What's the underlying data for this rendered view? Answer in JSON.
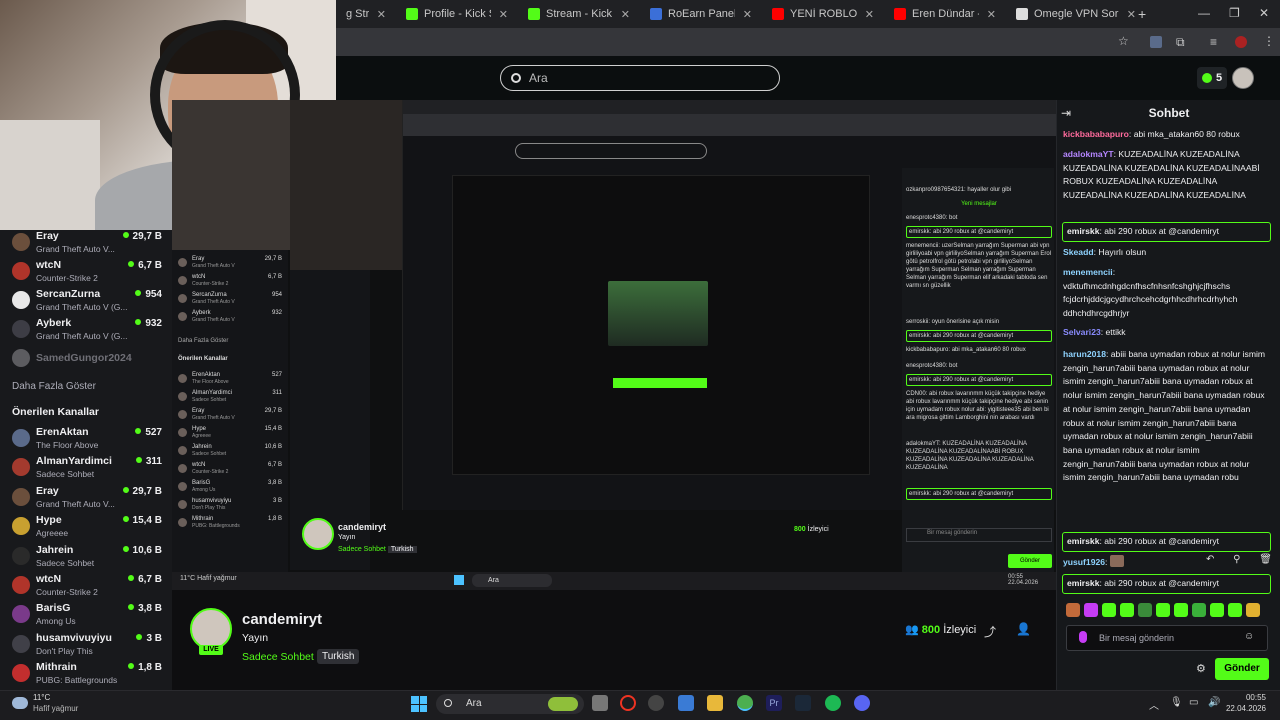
{
  "browser": {
    "tabs": [
      {
        "label": "g Stream",
        "color": "#53fc18"
      },
      {
        "label": "Profile - Kick Streami",
        "color": "#53fc18"
      },
      {
        "label": "Stream - Kick Dashbo",
        "color": "#53fc18"
      },
      {
        "label": "RoEarn Paneli",
        "color": "#3b6fd8"
      },
      {
        "label": "YENİ ROBLOX ÇIKTI",
        "color": "#ff0000"
      },
      {
        "label": "Eren Dündar - YouTu",
        "color": "#ff0000"
      },
      {
        "label": "Omegle VPN Sorunu",
        "color": "#dddddd"
      }
    ],
    "new_tab": "+"
  },
  "header": {
    "search_placeholder": "Ara",
    "points": "5"
  },
  "sidebar": {
    "channels_top": [
      {
        "name": "Eray",
        "game": "Grand Theft Auto V...",
        "viewers": "29,7 B",
        "avatar": "#6b4f3c"
      },
      {
        "name": "wtcN",
        "game": "Counter-Strike 2",
        "viewers": "6,7 B",
        "avatar": "#b0342a"
      },
      {
        "name": "SercanZurna",
        "game": "Grand Theft Auto V (G...",
        "viewers": "954",
        "avatar": "#e8e8e8"
      },
      {
        "name": "Ayberk",
        "game": "Grand Theft Auto V (G...",
        "viewers": "932",
        "avatar": "#3d3d45"
      },
      {
        "name": "SamedGungor2024",
        "game": "",
        "viewers": "",
        "avatar": "#5c5c60"
      }
    ],
    "show_more": "Daha Fazla Göster",
    "recommended_title": "Önerilen Kanallar",
    "recommended": [
      {
        "name": "ErenAktan",
        "game": "The Floor Above",
        "viewers": "527",
        "avatar": "#5a6a8a"
      },
      {
        "name": "AlmanYardimci",
        "game": "Sadece Sohbet",
        "viewers": "311",
        "avatar": "#a33a2e"
      },
      {
        "name": "Eray",
        "game": "Grand Theft Auto V...",
        "viewers": "29,7 B",
        "avatar": "#6b4f3c"
      },
      {
        "name": "Hype",
        "game": "Agreeee",
        "viewers": "15,4 B",
        "avatar": "#c8a030"
      },
      {
        "name": "Jahrein",
        "game": "Sadece Sohbet",
        "viewers": "10,6 B",
        "avatar": "#2a2a2a"
      },
      {
        "name": "wtcN",
        "game": "Counter-Strike 2",
        "viewers": "6,7 B",
        "avatar": "#b0342a"
      },
      {
        "name": "BarisG",
        "game": "Among Us",
        "viewers": "3,8 B",
        "avatar": "#7a3a8a"
      },
      {
        "name": "husamvivuyiyu",
        "game": "Don't Play This",
        "viewers": "3 B",
        "avatar": "#404048"
      },
      {
        "name": "Mithrain",
        "game": "PUBG: Battlegrounds",
        "viewers": "1,8 B",
        "avatar": "#c22e2e"
      }
    ]
  },
  "stream": {
    "streamer": "candemiryt",
    "live": "LIVE",
    "title": "Yayın",
    "category": "Sadece Sohbet",
    "language": "Turkish",
    "viewers": "800",
    "viewers_label": "İzleyici"
  },
  "chat": {
    "title": "Sohbet",
    "messages": [
      {
        "user": "kickbababapuro",
        "color": "#ff6b9d",
        "text": "abi mka_atakan60 80 robux",
        "highlight": false
      },
      {
        "user": "adalokmaYT",
        "color": "#b586ff",
        "text": "KUZEADALİNA KUZEADALİNA KUZEADALİNA KUZEADALİNA KUZEADALİNAABİ ROBUX KUZEADALİNA KUZEADALİNA KUZEADALİNA KUZEADALİNA KUZEADALİNA",
        "highlight": false
      },
      {
        "user": "emirskk",
        "color": "#efeff1",
        "text": "abi 290 robux at @candemiryt",
        "highlight": true
      },
      {
        "user": "Skeadd",
        "color": "#8fd3ff",
        "text": "Hayırlı olsun",
        "highlight": false
      },
      {
        "user": "menemencii",
        "color": "#8fd3ff",
        "text": "vdktufhmcdnhgdcnfhscfnhsnfcshghjcjfhschs fcjdcrhjddcjgcydhrchcehcdgrhhcdhrhcdrhyhch ddhchdhrcgdhrjyr",
        "highlight": false
      },
      {
        "user": "Selvari23",
        "color": "#8a8cff",
        "text": "ettikk",
        "highlight": false
      },
      {
        "user": "harun2018",
        "color": "#8fd3ff",
        "text": "abiii bana uymadan robux at nolur ismim zengin_harun7abiii bana uymadan robux at nolur ismim zengin_harun7abiii bana uymadan robux at nolur ismim zengin_harun7abiii bana uymadan robux at nolur ismim zengin_harun7abiii bana uymadan robux at nolur ismim zengin_harun7abiii bana uymadan robux at nolur ismim zengin_harun7abiii bana uymadan robux at nolur ismim zengin_harun7abiii bana uymadan robux at nolur ismim zengin_harun7abiii bana uymadan robu",
        "highlight": false
      },
      {
        "user": "emirskk",
        "color": "#efeff1",
        "text": "abi 290 robux at @candemiryt",
        "highlight": true
      },
      {
        "user": "yusuf1926",
        "color": "#8fd3ff",
        "text": "",
        "highlight": false
      },
      {
        "user": "emirskk",
        "color": "#efeff1",
        "text": "abi 290 robux at @candemiryt",
        "highlight": true
      }
    ],
    "input_placeholder": "Bir mesaj gönderin",
    "send_label": "Gönder"
  },
  "taskbar": {
    "temperature": "11°C",
    "weather": "Hafif yağmur",
    "search": "Ara",
    "time": "00:55",
    "date": "22.04.2026"
  }
}
